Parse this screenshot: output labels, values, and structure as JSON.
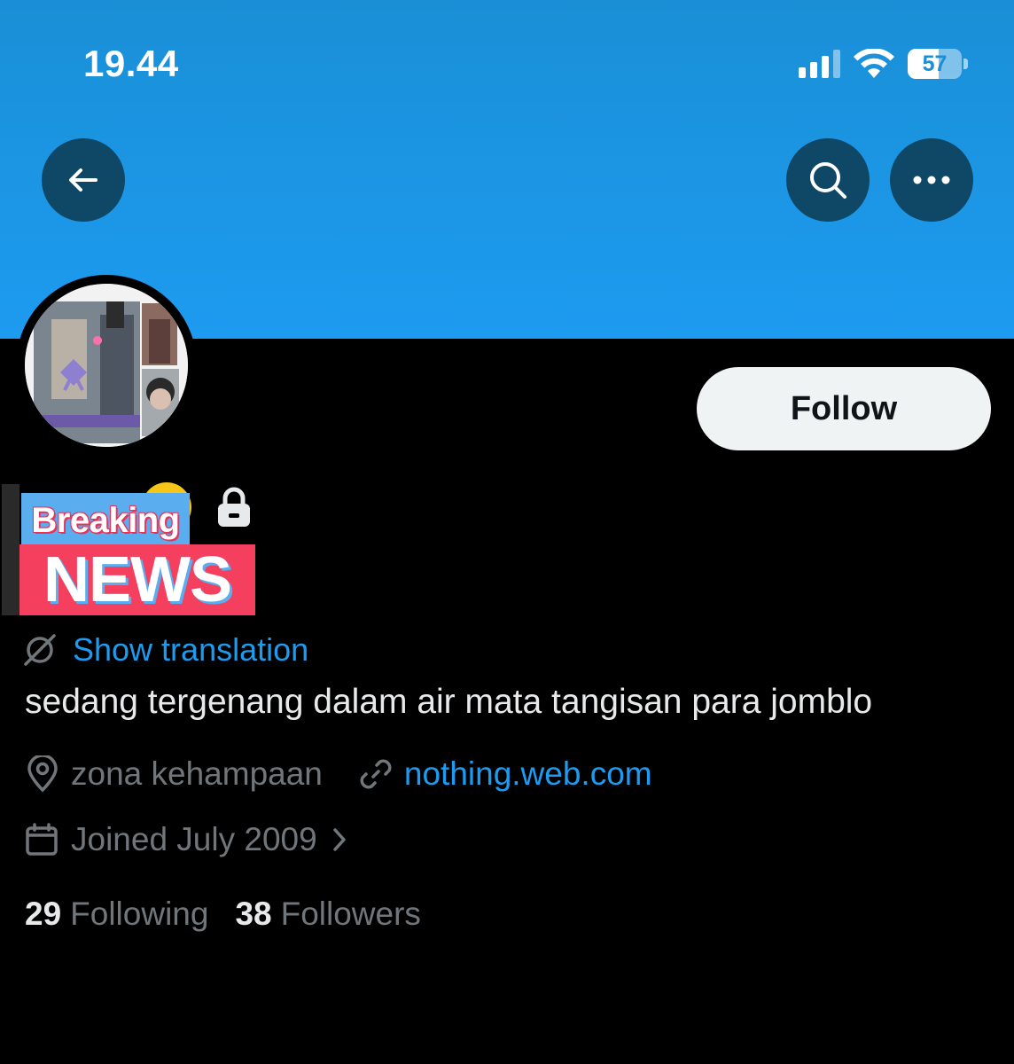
{
  "status_bar": {
    "time": "19.44",
    "battery": "57",
    "battery_fraction": 0.57
  },
  "header": {
    "back_icon": "arrow-left-icon",
    "search_icon": "search-icon",
    "more_icon": "more-horizontal-icon"
  },
  "profile": {
    "follow_label": "Follow",
    "name_sticker_top": "Breaking",
    "name_sticker_bottom": "NEWS",
    "translate_label": "Show translation",
    "bio": "sedang tergenang dalam air mata tangisan para jomblo",
    "location": "zona kehampaan",
    "website": "nothing.web.com",
    "joined": "Joined July 2009",
    "following_count": "29",
    "following_label": "Following",
    "followers_count": "38",
    "followers_label": "Followers"
  },
  "colors": {
    "banner": "#1d9bf0",
    "accent": "#1d9bf0",
    "muted": "#71767b",
    "text": "#e7e9ea",
    "background": "#000000"
  }
}
